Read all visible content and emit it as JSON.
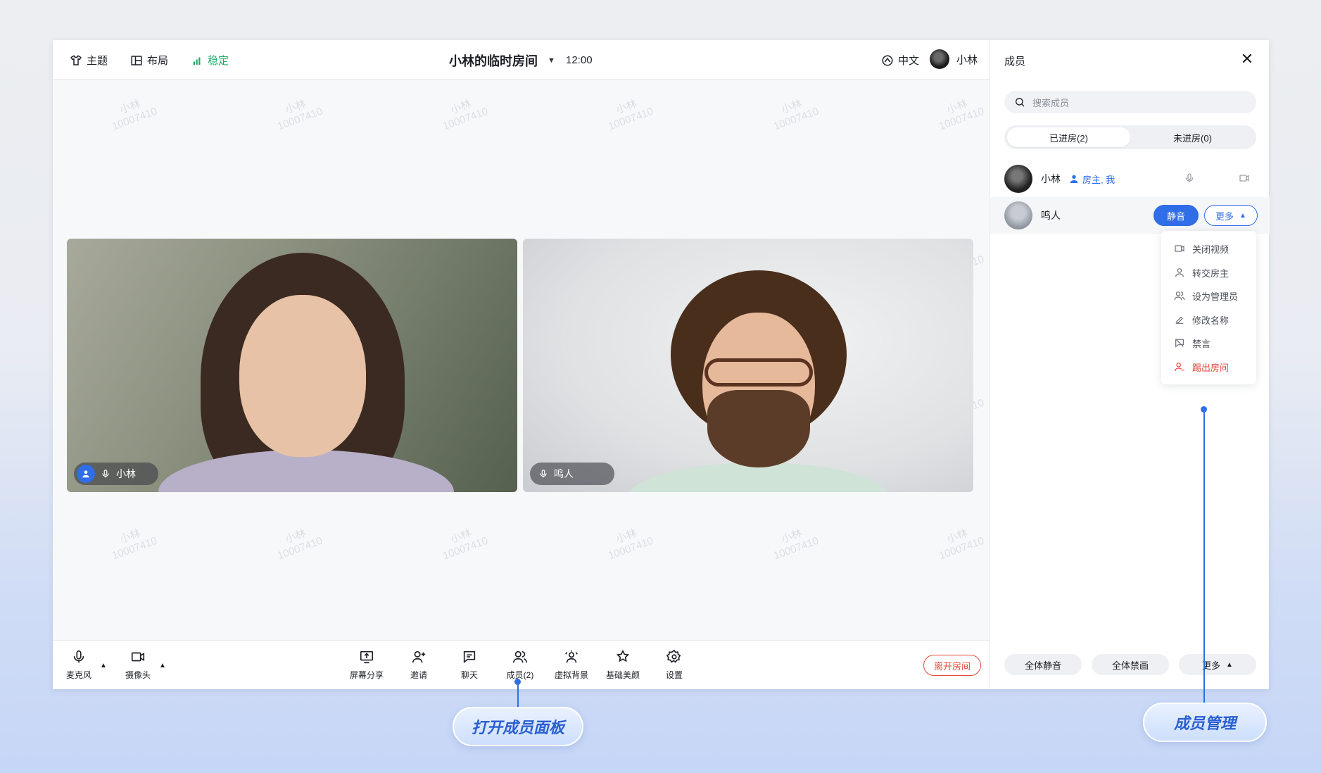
{
  "topbar": {
    "theme_label": "主题",
    "layout_label": "布局",
    "network_label": "稳定",
    "room_title": "小林的临时房间",
    "time": "12:00",
    "language_label": "中文",
    "user_name": "小林"
  },
  "watermark": {
    "line1": "小林",
    "line2": "10007410"
  },
  "stage": {
    "tiles": [
      {
        "name": "小林",
        "is_host": true
      },
      {
        "name": "鸣人",
        "is_host": false
      }
    ]
  },
  "toolbar": {
    "mic_label": "麦克风",
    "camera_label": "摄像头",
    "screen_share_label": "屏幕分享",
    "invite_label": "邀请",
    "chat_label": "聊天",
    "members_label": "成员(2)",
    "virtual_bg_label": "虚拟背景",
    "beauty_label": "基础美颜",
    "settings_label": "设置",
    "leave_label": "离开房间"
  },
  "panel": {
    "title": "成员",
    "search_placeholder": "搜索成员",
    "tab_in_room": "已进房(2)",
    "tab_not_in_room": "未进房(0)",
    "members": [
      {
        "name": "小林",
        "role": "房主, 我"
      },
      {
        "name": "鸣人",
        "mute_label": "静音",
        "more_label": "更多"
      }
    ],
    "dropdown": [
      {
        "label": "关闭视频",
        "icon": "video-icon"
      },
      {
        "label": "转交房主",
        "icon": "user-icon"
      },
      {
        "label": "设为管理员",
        "icon": "users-icon"
      },
      {
        "label": "修改名称",
        "icon": "edit-icon"
      },
      {
        "label": "禁言",
        "icon": "chat-off-icon"
      },
      {
        "label": "踢出房间",
        "icon": "kick-user-icon"
      }
    ],
    "footer": {
      "mute_all_label": "全体静音",
      "disable_video_all_label": "全体禁画",
      "more_label": "更多"
    }
  },
  "annotations": {
    "open_panel": "打开成员面板",
    "member_management": "成员管理"
  },
  "colors": {
    "accent": "#2f6ee7",
    "danger": "#e5483d",
    "stable": "#22a86a"
  }
}
